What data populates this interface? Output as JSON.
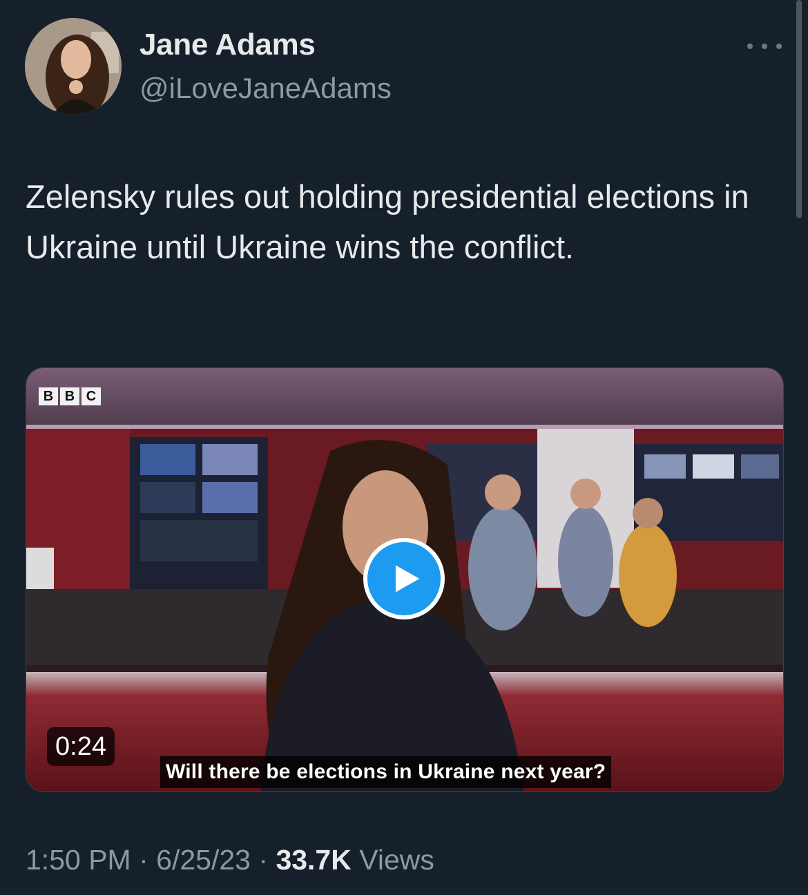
{
  "author": {
    "display_name": "Jane Adams",
    "handle": "@iLoveJaneAdams",
    "avatar_icon": "profile-photo"
  },
  "tweet": {
    "text": "Zelensky rules out holding presidential elections in Ukraine until Ukraine wins the conflict."
  },
  "media": {
    "logo_letters": [
      "B",
      "B",
      "C"
    ],
    "duration": "0:24",
    "caption": "Will there be elections in Ukraine next year?",
    "play_icon": "play-icon"
  },
  "meta": {
    "time": "1:50 PM",
    "separator": "·",
    "date": "6/25/23",
    "views_count": "33.7K",
    "views_label": "Views"
  },
  "colors": {
    "background": "#15202b",
    "accent": "#1d9bf0",
    "secondary_text": "#8b98a5"
  }
}
